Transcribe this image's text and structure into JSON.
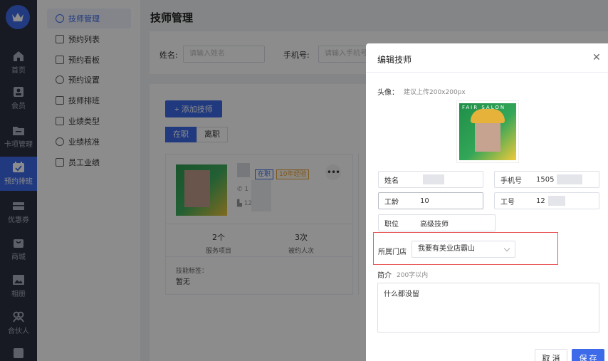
{
  "rail": {
    "items": [
      {
        "label": "首页",
        "icon": "home-icon"
      },
      {
        "label": "会员",
        "icon": "member-icon"
      },
      {
        "label": "卡项管理",
        "icon": "folder-icon"
      },
      {
        "label": "预约排班",
        "icon": "calendar-icon",
        "active": true
      },
      {
        "label": "优惠券",
        "icon": "coupon-icon"
      },
      {
        "label": "商城",
        "icon": "mall-icon"
      },
      {
        "label": "相册",
        "icon": "album-icon"
      },
      {
        "label": "合伙人",
        "icon": "partner-icon"
      }
    ]
  },
  "submenu": {
    "items": [
      {
        "label": "技师管理",
        "active": true
      },
      {
        "label": "预约列表"
      },
      {
        "label": "预约看板"
      },
      {
        "label": "预约设置"
      },
      {
        "label": "技师排班"
      },
      {
        "label": "业绩类型"
      },
      {
        "label": "业绩核准"
      },
      {
        "label": "员工业绩"
      }
    ]
  },
  "page": {
    "title": "技师管理",
    "filter": {
      "name_label": "姓名:",
      "name_placeholder": "请输入姓名",
      "phone_label": "手机号:",
      "phone_placeholder": "请输入手机号"
    },
    "add_button": "+ 添加技师",
    "tabs": [
      "在职",
      "离职"
    ],
    "card": {
      "status_tag": "在职",
      "experience_tag": "10年经验",
      "phone_prefix": "1",
      "shop_prefix": "12",
      "stats": [
        {
          "value": "2个",
          "label": "服务项目"
        },
        {
          "value": "3次",
          "label": "被约人次"
        }
      ],
      "skill_label": "技能标签：",
      "skill_value": "暂无"
    }
  },
  "drawer": {
    "title": "编辑技师",
    "avatar_label": "头像：",
    "avatar_hint": "建议上传200x200px",
    "avatar_text": "FAIR SALON",
    "fields": {
      "name_label": "姓名",
      "phone_label": "手机号",
      "phone_value": "1505",
      "age_label": "工龄",
      "age_value": "10",
      "jobno_label": "工号",
      "jobno_value": "12",
      "position_label": "职位",
      "position_value": "高级技师"
    },
    "store_label": "所属门店",
    "store_value": "我要有美业店霸山",
    "intro_label": "简介",
    "intro_hint": "200字以内",
    "intro_value": "什么都没留",
    "cancel": "取 消",
    "save": "保 存"
  },
  "colors": {
    "primary": "#3d6ae8",
    "rail": "#2b3140",
    "highlight": "#e85a5a"
  }
}
